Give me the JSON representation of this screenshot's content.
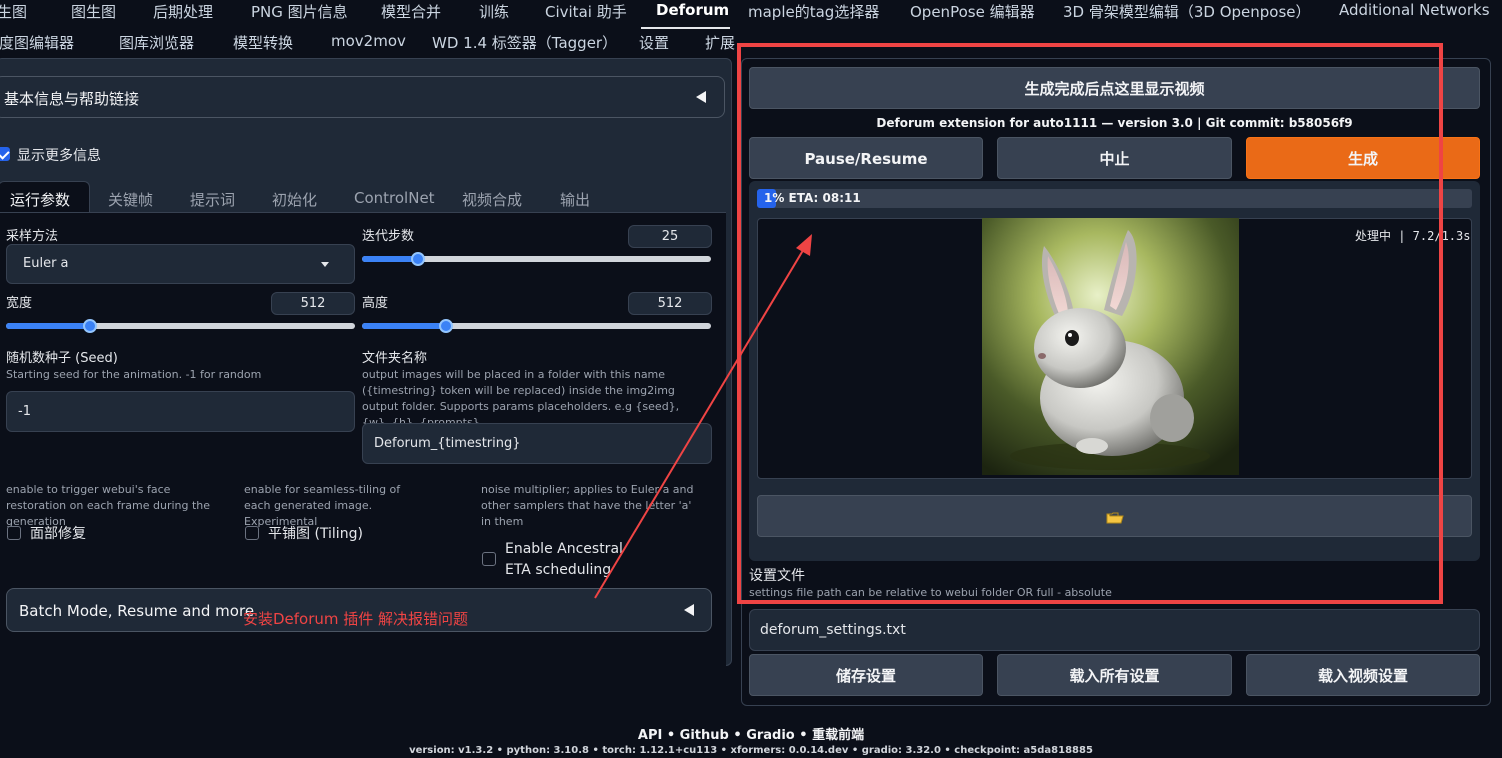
{
  "top_tabs_row1": [
    "文生图",
    "图生图",
    "后期处理",
    "PNG 图片信息",
    "模型合并",
    "训练",
    "Civitai 助手",
    "Deforum",
    "maple的tag选择器",
    "OpenPose 编辑器",
    "3D 骨架模型编辑（3D Openpose）",
    "Additional Networks"
  ],
  "top_tabs_row2": [
    "深度图编辑器",
    "图库浏览器",
    "模型转换",
    "mov2mov",
    "WD 1.4 标签器（Tagger）",
    "设置",
    "扩展"
  ],
  "active_tab": "Deforum",
  "left": {
    "info_accordion": "基本信息与帮助链接",
    "show_more_info": "显示更多信息",
    "sub_tabs": [
      "运行参数",
      "关键帧",
      "提示词",
      "初始化",
      "ControlNet",
      "视频合成",
      "输出"
    ],
    "sampler_label": "采样方法",
    "sampler_value": "Euler a",
    "steps_label": "迭代步数",
    "steps_value": "25",
    "width_label": "宽度",
    "width_value": "512",
    "height_label": "高度",
    "height_value": "512",
    "seed_label": "随机数种子 (Seed)",
    "seed_desc": "Starting seed for the animation. -1 for random",
    "seed_value": "-1",
    "folder_label": "文件夹名称",
    "folder_desc": "output images will be placed in a folder with this name ({timestring} token will be replaced) inside the img2img output folder. Supports params placeholders. e.g {seed}, {w}, {h}, {prompts}",
    "folder_value": "Deforum_{timestring}",
    "face_desc": "enable to trigger webui's face restoration on each frame during the generation",
    "face_label": "面部修复",
    "tiling_desc": "enable for seamless-tiling of each generated image. Experimental",
    "tiling_label": "平铺图 (Tiling)",
    "eta_desc": "noise multiplier; applies to Euler a and other samplers that have the letter 'a' in them",
    "eta_label": "Enable Ancestral ETA scheduling",
    "batch_accordion": "Batch Mode, Resume and more",
    "annotation": "安装Deforum 插件 解决报错问题",
    "annotation_color": "#ef4444"
  },
  "slider_levels": {
    "steps": 0.16,
    "width": 0.24,
    "height": 0.24
  },
  "right": {
    "video_button": "生成完成后点这里显示视频",
    "version_text": "Deforum extension for auto1111 — version 3.0 | Git commit: b58056f9",
    "pause_button": "Pause/Resume",
    "interrupt_button": "中止",
    "generate_button": "生成",
    "progress_text": "1% ETA: 08:11",
    "progress_fraction": 0.01,
    "status_text": "处理中 | 7.2/1.3s",
    "folder_icon": "folder-icon",
    "settings_label": "设置文件",
    "settings_desc": "settings file path can be relative to webui folder OR full - absolute",
    "settings_value": "deforum_settings.txt",
    "save_button": "储存设置",
    "load_all_button": "载入所有设置",
    "load_video_button": "载入视频设置"
  },
  "footer": {
    "links": "API  •  Github  •  Gradio  •  重载前端",
    "versions": "version: v1.3.2  •  python: 3.10.8  •  torch: 1.12.1+cu113  •  xformers: 0.0.14.dev  •  gradio: 3.32.0  •  checkpoint: a5da818885"
  },
  "colors": {
    "accent": "#3b82f6",
    "generate": "#ea6a17",
    "annotation": "#ef4444"
  }
}
